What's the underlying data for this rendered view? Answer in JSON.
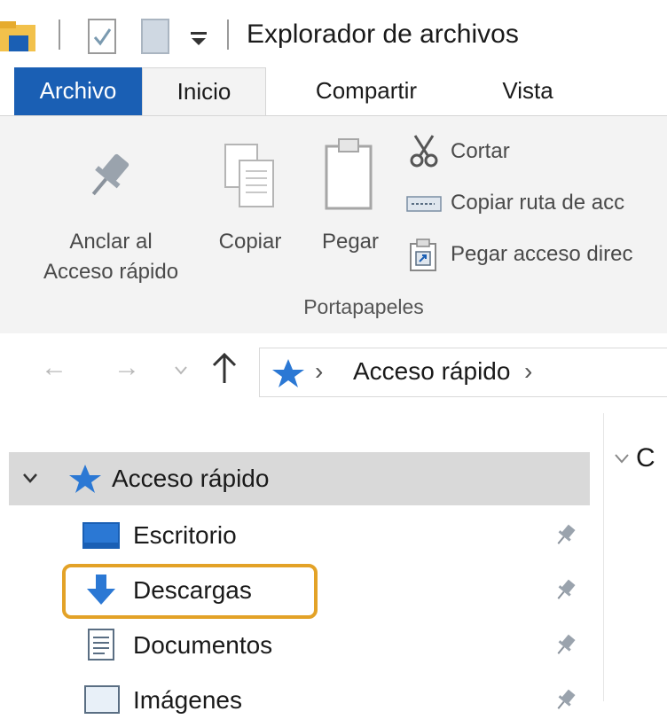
{
  "window": {
    "title": "Explorador de archivos"
  },
  "ribbon": {
    "tabs": [
      {
        "label": "Archivo",
        "active": false,
        "accent": "#1a5fb4"
      },
      {
        "label": "Inicio",
        "active": true
      },
      {
        "label": "Compartir",
        "active": false
      },
      {
        "label": "Vista",
        "active": false
      }
    ],
    "clipboard": {
      "pin_label_line1": "Anclar al",
      "pin_label_line2": "Acceso rápido",
      "copy_label": "Copiar",
      "paste_label": "Pegar",
      "cut_label": "Cortar",
      "copy_path_label": "Copiar ruta de acc",
      "paste_shortcut_label": "Pegar acceso direc",
      "group_label": "Portapapeles"
    }
  },
  "address_bar": {
    "location": "Acceso rápido",
    "separator": "›"
  },
  "nav_pane": {
    "root": {
      "label": "Acceso rápido",
      "expanded": true
    },
    "items": [
      {
        "label": "Escritorio",
        "icon": "desktop-icon",
        "pinned": true
      },
      {
        "label": "Descargas",
        "icon": "downloads-icon",
        "pinned": true,
        "highlighted": true
      },
      {
        "label": "Documentos",
        "icon": "documents-icon",
        "pinned": true
      },
      {
        "label": "Imágenes",
        "icon": "pictures-icon",
        "pinned": true
      }
    ]
  },
  "content": {
    "group_initial": "C"
  },
  "colors": {
    "accent": "#1a5fb4",
    "highlight": "#e3a227",
    "ribbon_bg": "#f3f3f3",
    "selected_row": "#d9d9d9"
  }
}
